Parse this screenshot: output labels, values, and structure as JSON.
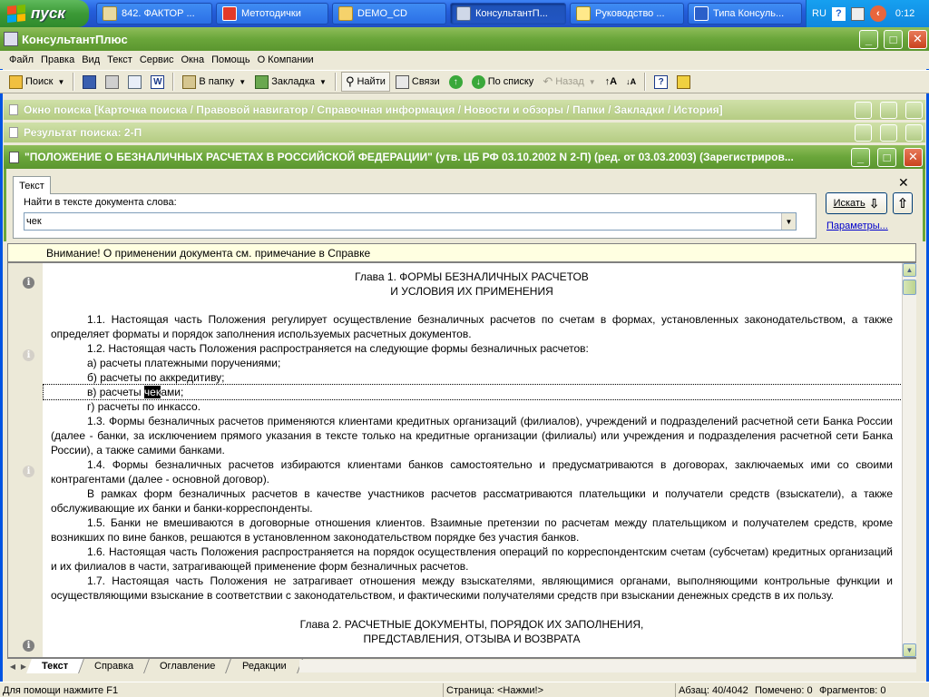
{
  "taskbar": {
    "start_label": "пуск",
    "buttons": [
      {
        "label": "842. ФАКТОР ...",
        "icon": "document-icon",
        "active": false
      },
      {
        "label": "Метотодички",
        "icon": "red-app-icon",
        "active": false
      },
      {
        "label": "DEMO_CD",
        "icon": "folder-icon",
        "active": false
      },
      {
        "label": "КонсультантП...",
        "icon": "consultant-icon",
        "active": true
      },
      {
        "label": "Руководство ...",
        "icon": "help-book-icon",
        "active": false
      },
      {
        "label": "Типа Консуль...",
        "icon": "word-icon",
        "active": false
      }
    ],
    "tray": {
      "lang": "RU",
      "time": "0:12"
    }
  },
  "app": {
    "title": "КонсультантПлюс",
    "menu": [
      "Файл",
      "Правка",
      "Вид",
      "Текст",
      "Сервис",
      "Окна",
      "Помощь",
      "О Компании"
    ],
    "toolbar": {
      "search": "Поиск",
      "to_folder": "В папку",
      "bookmark": "Закладка",
      "find": "Найти",
      "links": "Связи",
      "by_list": "По списку",
      "back": "Назад"
    }
  },
  "windows": {
    "search_window": "Окно поиска [Карточка поиска / Правовой навигатор / Справочная информация / Новости и обзоры / Папки / Закладки / История]",
    "search_result": "Результат поиска: 2-П",
    "document_title": "\"ПОЛОЖЕНИЕ О БЕЗНАЛИЧНЫХ РАСЧЕТАХ В РОССИЙСКОЙ ФЕДЕРАЦИИ\" (утв. ЦБ РФ 03.10.2002 N 2-П) (ред. от 03.03.2003) (Зарегистриров..."
  },
  "find_panel": {
    "tab": "Текст",
    "label": "Найти в тексте документа слова:",
    "value": "чек",
    "search_button": "Искать",
    "params_link": "Параметры..."
  },
  "notice": "Внимание! О применении документа см. примечание в Справке",
  "document": {
    "heading1_line1": "Глава 1. ФОРМЫ БЕЗНАЛИЧНЫХ РАСЧЕТОВ",
    "heading1_line2": "И УСЛОВИЯ ИХ ПРИМЕНЕНИЯ",
    "p1_1": "1.1. Настоящая часть Положения регулирует осуществление безналичных расчетов по счетам в формах, установленных законодательством, а также определяет форматы и порядок заполнения используемых расчетных документов.",
    "p1_2": "1.2. Настоящая часть Положения распространяется на следующие формы безналичных расчетов:",
    "item_a": "а) расчеты платежными поручениями;",
    "item_b": "б) расчеты по аккредитиву;",
    "item_v_pre": "в) расчеты ",
    "item_v_hl": "чек",
    "item_v_post": "ами;",
    "item_g": "г) расчеты по инкассо.",
    "p1_3": "1.3. Формы безналичных расчетов применяются клиентами кредитных организаций (филиалов), учреждений и подразделений расчетной сети Банка России (далее - банки, за исключением прямого указания в тексте только на кредитные организации (филиалы) или учреждения и подразделения расчетной сети Банка России), а также самими банками.",
    "p1_4": "1.4. Формы безналичных расчетов избираются клиентами банков самостоятельно и предусматриваются в договорах, заключаемых ими со своими контрагентами (далее - основной договор).",
    "p1_4b": "В рамках форм безналичных расчетов в качестве участников расчетов рассматриваются плательщики и получатели средств (взыскатели), а также обслуживающие их банки и банки-корреспонденты.",
    "p1_5": "1.5. Банки не вмешиваются в договорные отношения клиентов. Взаимные претензии по расчетам между плательщиком и получателем средств, кроме возникших по вине банков, решаются в установленном законодательством порядке без участия банков.",
    "p1_6": "1.6. Настоящая часть Положения распространяется на порядок осуществления операций по корреспондентским счетам (субсчетам) кредитных организаций и их филиалов в части, затрагивающей применение форм безналичных расчетов.",
    "p1_7": "1.7. Настоящая часть Положения не затрагивает отношения между взыскателями, являющимися органами, выполняющими контрольные функции и осуществляющими взыскание в соответствии с законодательством, и фактическими получателями средств при взыскании денежных средств в их пользу.",
    "heading2_line1": "Глава 2. РАСЧЕТНЫЕ ДОКУМЕНТЫ, ПОРЯДОК ИХ ЗАПОЛНЕНИЯ,",
    "heading2_line2": "ПРЕДСТАВЛЕНИЯ, ОТЗЫВА И ВОЗВРАТА"
  },
  "bottom_tabs": [
    "Текст",
    "Справка",
    "Оглавление",
    "Редакции"
  ],
  "status": {
    "help": "Для помощи нажмите F1",
    "page": "Страница: <Нажми!>",
    "paragraph": "Абзац: 40/4042",
    "marked": "Помечено: 0",
    "fragments": "Фрагментов: 0"
  }
}
